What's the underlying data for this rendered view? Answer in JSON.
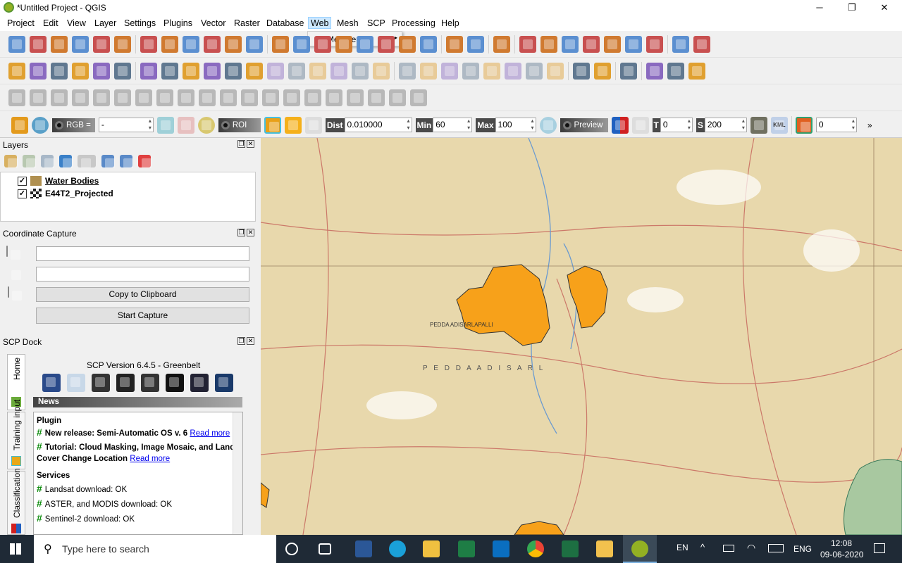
{
  "window": {
    "title": "*Untitled Project - QGIS",
    "minimize": "─",
    "maximize": "❐",
    "close": "✕"
  },
  "menus": [
    "Project",
    "Edit",
    "View",
    "Layer",
    "Settings",
    "Plugins",
    "Vector",
    "Raster",
    "Database",
    "Web",
    "Mesh",
    "SCP",
    "Processing",
    "Help"
  ],
  "web_menu": {
    "items": [
      {
        "label": "MetaSearch",
        "submenu_arrow": "▸"
      }
    ]
  },
  "toolbar_rows": [
    [
      "new-project",
      "open-project",
      "save-project",
      "save-as",
      "print-layout",
      "style-manager",
      "|",
      "pan",
      "pan-to-selection",
      "zoom-in",
      "zoom-out",
      "zoom-full",
      "zoom-layer",
      "|",
      "zoom-selection",
      "zoom-last",
      "zoom-next",
      "new-map-view",
      "new-3d-view",
      "bookmark",
      "show-bookmarks",
      "refresh",
      "|",
      "identify",
      "select-by-area",
      "|",
      "select-features",
      "|",
      "open-attribute-table",
      "deselect",
      "field-calculator",
      "statistics",
      "toolbox",
      "sum",
      "measure",
      "|",
      "map-tips",
      "text-annotation"
    ],
    [
      "data-source-manager",
      "new-geopackage",
      "new-shapefile",
      "digitize",
      "add-raster",
      "new-virtual-layer",
      "|",
      "current-edits",
      "toggle-editing",
      "save-edits",
      "add-feature",
      "vertex-tool",
      "modify-attributes",
      "delete",
      "cut",
      "copy",
      "paste",
      "undo",
      "redo",
      "|",
      "label",
      "diagram",
      "pin-labels",
      "hide-labels",
      "show-labels",
      "move-label",
      "rotate-label",
      "change-label",
      "|",
      "georeferencer",
      "python-console",
      "|",
      "help",
      "|",
      "digitize-coords",
      "gps",
      "osm"
    ],
    [
      "measure-angle",
      "add-ring",
      "add-part",
      "fill-ring",
      "delete-ring",
      "delete-part",
      "reshape",
      "offset-curve",
      "split-features",
      "split-parts",
      "merge-selected",
      "merge-attributes",
      "rotate-symbols",
      "simplify",
      "add-vertex",
      "split",
      "split-2",
      "tracing",
      "align",
      "shape-digitize"
    ]
  ],
  "scp": {
    "rgb_label": "RGB =",
    "rgb_value": "-",
    "roi_label": "ROI",
    "dist_label": "Dist",
    "dist_value": "0.010000",
    "min_label": "Min",
    "min_value": "60",
    "max_label": "Max",
    "max_value": "100",
    "preview_label": "Preview",
    "t_label": "T",
    "t_value": "0",
    "s_label": "S",
    "s_value": "200",
    "kml_label": "KML",
    "grid_value": "0",
    "more": "»"
  },
  "layers": {
    "title": "Layers",
    "items": [
      {
        "name": "Water Bodies",
        "checked": true
      },
      {
        "name": "E44T2_Projected",
        "checked": true
      }
    ]
  },
  "coord_capture": {
    "title": "Coordinate Capture",
    "field1": "",
    "field2": "",
    "copy_label": "Copy to Clipboard",
    "start_label": "Start Capture"
  },
  "scp_dock": {
    "title": "SCP Dock",
    "tabs": [
      "Home",
      "Training input",
      "Classification"
    ],
    "version": "SCP Version 6.4.5 - Greenbelt",
    "news_header": "News",
    "news": {
      "plugin_heading": "Plugin",
      "item1": "New release: Semi-Automatic OS v. 6",
      "item2": "Tutorial: Cloud Masking, Image Mosaic, and Land Cover Change Location",
      "read_more_1": "Read more",
      "read_more_2": "Read more",
      "services_heading": "Services",
      "services": [
        "Landsat download: OK",
        "ASTER, and MODIS download: OK",
        "Sentinel-2 download: OK"
      ],
      "hash": "#"
    }
  },
  "map": {
    "labels": [
      "PEDDA ADISARLAPALLI",
      "P E D D A   A D I S A R L"
    ]
  },
  "taskbar": {
    "search_placeholder": "Type here to search",
    "lang": "EN",
    "input": "ENG",
    "time": "12:08",
    "date": "09-06-2020"
  },
  "colors": {
    "polygon": "#f7a11a",
    "map_bg": "#e8d8ac",
    "accent": "#cce8ff"
  }
}
